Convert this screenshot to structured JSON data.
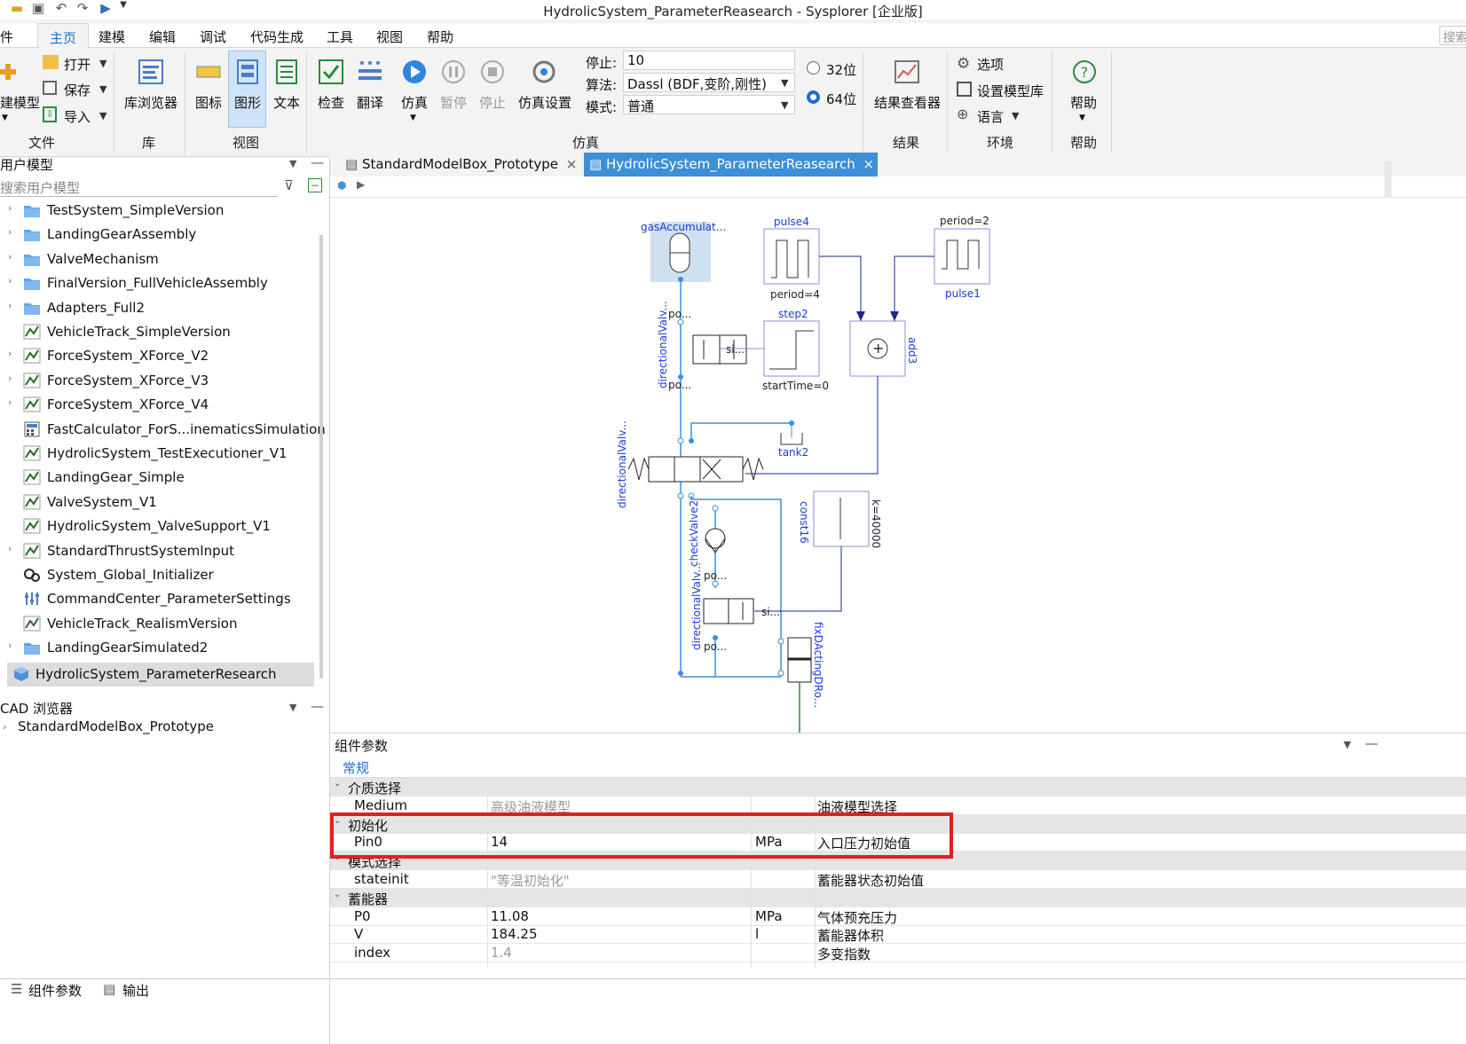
{
  "window": {
    "title": "HydrolicSystem_ParameterReasearch - Sysplorer [企业版]"
  },
  "menu": {
    "items": [
      "文件",
      "主页",
      "建模",
      "编辑",
      "调试",
      "代码生成",
      "工具",
      "视图",
      "帮助"
    ],
    "search_placeholder": "搜索"
  },
  "ribbon": {
    "file": {
      "new_model": "建模型",
      "open": "打开",
      "save": "保存",
      "import": "导入",
      "group": "文件"
    },
    "library": {
      "browser": "库浏览器",
      "group": "库"
    },
    "view": {
      "icon": "图标",
      "graphic": "图形",
      "text": "文本",
      "group": "视图"
    },
    "check": {
      "check": "检查",
      "translate": "翻译"
    },
    "simulate": {
      "sim": "仿真",
      "pause": "暂停",
      "stop": "停止",
      "settings": "仿真设置",
      "group": "仿真"
    },
    "sim_params": {
      "stop_label": "停止:",
      "stop_value": "10",
      "algo_label": "算法:",
      "algo_value": "Dassl (BDF,变阶,刚性)",
      "mode_label": "模式:",
      "mode_value": "普通",
      "bit32": "32位",
      "bit64": "64位"
    },
    "results": {
      "viewer": "结果查看器",
      "group": "结果"
    },
    "env": {
      "options": "选项",
      "model_lib": "设置模型库",
      "language": "语言",
      "group": "环境"
    },
    "help": {
      "help": "帮助",
      "group": "帮助"
    }
  },
  "user_models": {
    "header": "用户模型",
    "search_placeholder": "搜索用户模型",
    "items": [
      {
        "label": "TestSystem_SimpleVersion",
        "icon": "folder-icon",
        "expandable": true
      },
      {
        "label": "LandingGearAssembly",
        "icon": "folder-icon",
        "expandable": true
      },
      {
        "label": "ValveMechanism",
        "icon": "folder-icon",
        "expandable": true
      },
      {
        "label": "FinalVersion_FullVehicleAssembly",
        "icon": "folder-icon",
        "expandable": true
      },
      {
        "label": "Adapters_Full2",
        "icon": "folder-icon",
        "expandable": true
      },
      {
        "label": "VehicleTrack_SimpleVersion",
        "icon": "model-icon",
        "expandable": false
      },
      {
        "label": "ForceSystem_XForce_V2",
        "icon": "model-icon",
        "expandable": true
      },
      {
        "label": "ForceSystem_XForce_V3",
        "icon": "model-icon",
        "expandable": true
      },
      {
        "label": "ForceSystem_XForce_V4",
        "icon": "model-icon",
        "expandable": true
      },
      {
        "label": "FastCalculator_ForS...inematicsSimulation",
        "icon": "calculator-icon",
        "expandable": false
      },
      {
        "label": "HydrolicSystem_TestExecutioner_V1",
        "icon": "model-icon",
        "expandable": false
      },
      {
        "label": "LandingGear_Simple",
        "icon": "model-icon",
        "expandable": false
      },
      {
        "label": "ValveSystem_V1",
        "icon": "model-icon",
        "expandable": false
      },
      {
        "label": "HydrolicSystem_ValveSupport_V1",
        "icon": "model-icon",
        "expandable": false
      },
      {
        "label": "StandardThrustSystemInput",
        "icon": "model-icon",
        "expandable": true
      },
      {
        "label": "System_Global_Initializer",
        "icon": "gear-icon",
        "expandable": false
      },
      {
        "label": "CommandCenter_ParameterSettings",
        "icon": "settings-icon",
        "expandable": false
      },
      {
        "label": "VehicleTrack_RealismVersion",
        "icon": "model-icon",
        "expandable": false
      },
      {
        "label": "LandingGearSimulated2",
        "icon": "folder-icon",
        "expandable": true
      }
    ],
    "selected": "HydrolicSystem_ParameterResearch"
  },
  "cad_browser": {
    "header": "CAD 浏览器",
    "items": [
      "StandardModelBox_Prototype"
    ]
  },
  "tabs": [
    {
      "label": "StandardModelBox_Prototype",
      "active": false
    },
    {
      "label": "HydrolicSystem_ParameterReasearch",
      "active": true
    }
  ],
  "diagram": {
    "labels": {
      "gas": "gasAccumulat...",
      "pulse4": "pulse4",
      "period4": "period=4",
      "period2": "period=2",
      "pulse1": "pulse1",
      "step2": "step2",
      "starttime": "startTime=0",
      "add3": "add3",
      "tank2": "tank2",
      "dv_top": "directionalValv...",
      "dv_mid": "directionalValv...",
      "dv_low": "directionalValv...",
      "po1": "po...",
      "po2": "po...",
      "po3": "po...",
      "po4": "po...",
      "si1": "si...",
      "si2": "si...",
      "check": "checkValve2",
      "const": "const16",
      "k": "k=40000",
      "fix": "fixDActingDRo..."
    }
  },
  "params": {
    "header": "组件参数",
    "tab": "常规",
    "groups": [
      {
        "name": "介质选择",
        "rows": [
          {
            "name": "Medium",
            "value": "高级油液模型",
            "unit": "",
            "desc": "油液模型选择",
            "greyed": true
          }
        ]
      },
      {
        "name": "初始化",
        "rows": [
          {
            "name": "Pin0",
            "value": "14",
            "unit": "MPa",
            "desc": "入口压力初始值",
            "greyed": false
          }
        ]
      },
      {
        "name": "模式选择",
        "rows": [
          {
            "name": "stateinit",
            "value": "\"等温初始化\"",
            "unit": "",
            "desc": "蓄能器状态初始值",
            "greyed": true
          }
        ]
      },
      {
        "name": "蓄能器",
        "rows": [
          {
            "name": "P0",
            "value": "11.08",
            "unit": "MPa",
            "desc": "气体预充压力",
            "greyed": false
          },
          {
            "name": "V",
            "value": "184.25",
            "unit": "l",
            "desc": "蓄能器体积",
            "greyed": false
          },
          {
            "name": "index",
            "value": "1.4",
            "unit": "",
            "desc": "多变指数",
            "greyed": true
          }
        ]
      }
    ]
  },
  "bottom_tabs": [
    "组件参数",
    "输出"
  ]
}
